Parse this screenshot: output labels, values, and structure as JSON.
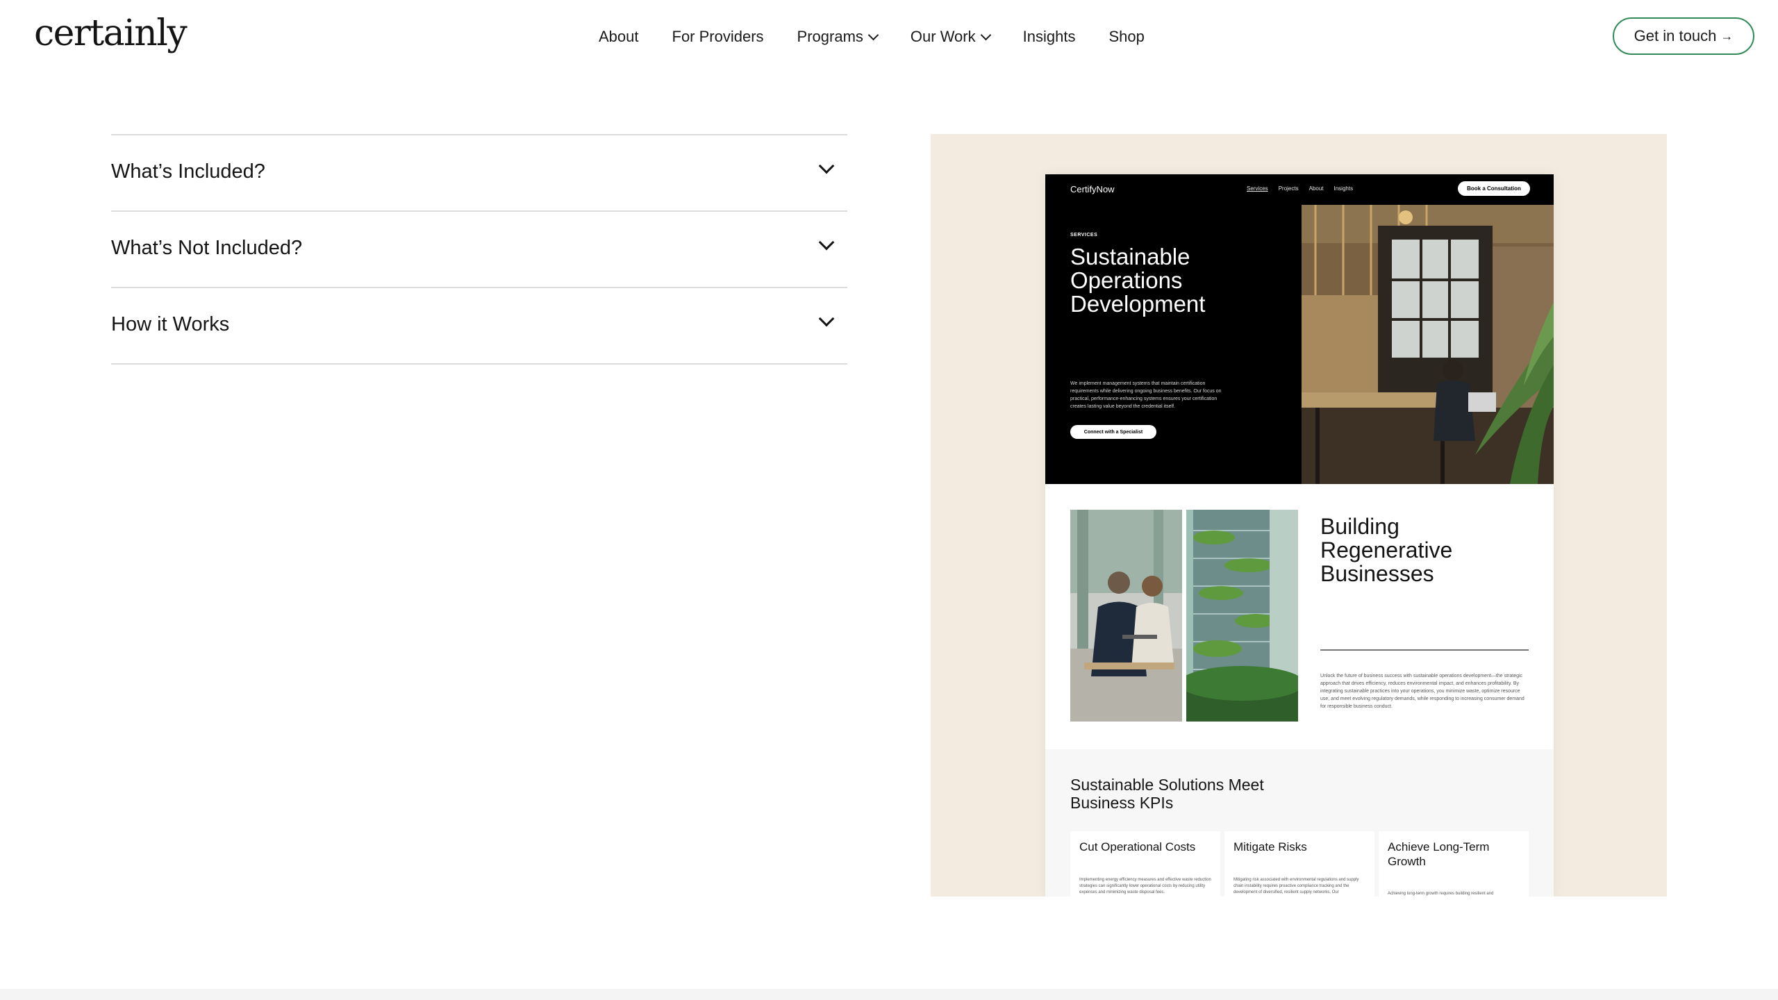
{
  "header": {
    "logo": "certainly",
    "nav": [
      {
        "label": "About",
        "has_dropdown": false
      },
      {
        "label": "For Providers",
        "has_dropdown": false
      },
      {
        "label": "Programs",
        "has_dropdown": true
      },
      {
        "label": "Our Work",
        "has_dropdown": true
      },
      {
        "label": "Insights",
        "has_dropdown": false
      },
      {
        "label": "Shop",
        "has_dropdown": false
      }
    ],
    "cta_label": "Get in touch",
    "cta_arrow": "→",
    "accent_color": "#2f8a58"
  },
  "accordion": {
    "items": [
      {
        "title": "What’s Included?"
      },
      {
        "title": "What’s Not Included?"
      },
      {
        "title": "How it Works"
      }
    ]
  },
  "preview": {
    "background": "#f3ebe0",
    "mock_site": {
      "brand": "CertifyNow",
      "nav": [
        "Services",
        "Projects",
        "About",
        "Insights"
      ],
      "book_button": "Book a Consultation",
      "hero": {
        "kicker": "SERVICES",
        "title": "Sustainable Operations Development",
        "description": "We implement management systems that maintain certification requirements while delivering ongoing business benefits. Our focus on practical, performance-enhancing systems ensures your certification creates lasting value beyond the credential itself.",
        "button": "Connect with a Specialist"
      },
      "section2": {
        "title": "Building Regenerative Businesses",
        "paragraph": "Unlock the future of business success with sustainable operations development—the strategic approach that drives efficiency, reduces environmental impact, and enhances profitability. By integrating sustainable practices into your operations, you minimize waste, optimize resource use, and meet evolving regulatory demands, while responding to increasing consumer demand for responsible business conduct."
      },
      "kpi_section": {
        "title": "Sustainable Solutions Meet Business KPIs",
        "cards": [
          {
            "title": "Cut Operational Costs",
            "text": "Implementing energy efficiency measures and effective waste reduction strategies can significantly lower operational costs by reducing utility expenses and minimizing waste disposal fees."
          },
          {
            "title": "Mitigate Risks",
            "text": "Mitigating risk associated with environmental regulations and supply chain instability requires proactive compliance tracking and the development of diversified, resilient supply networks. Our"
          },
          {
            "title": "Achieve Long-Term Growth",
            "text": "Achieving long-term growth requires building resilient and"
          }
        ]
      }
    }
  }
}
